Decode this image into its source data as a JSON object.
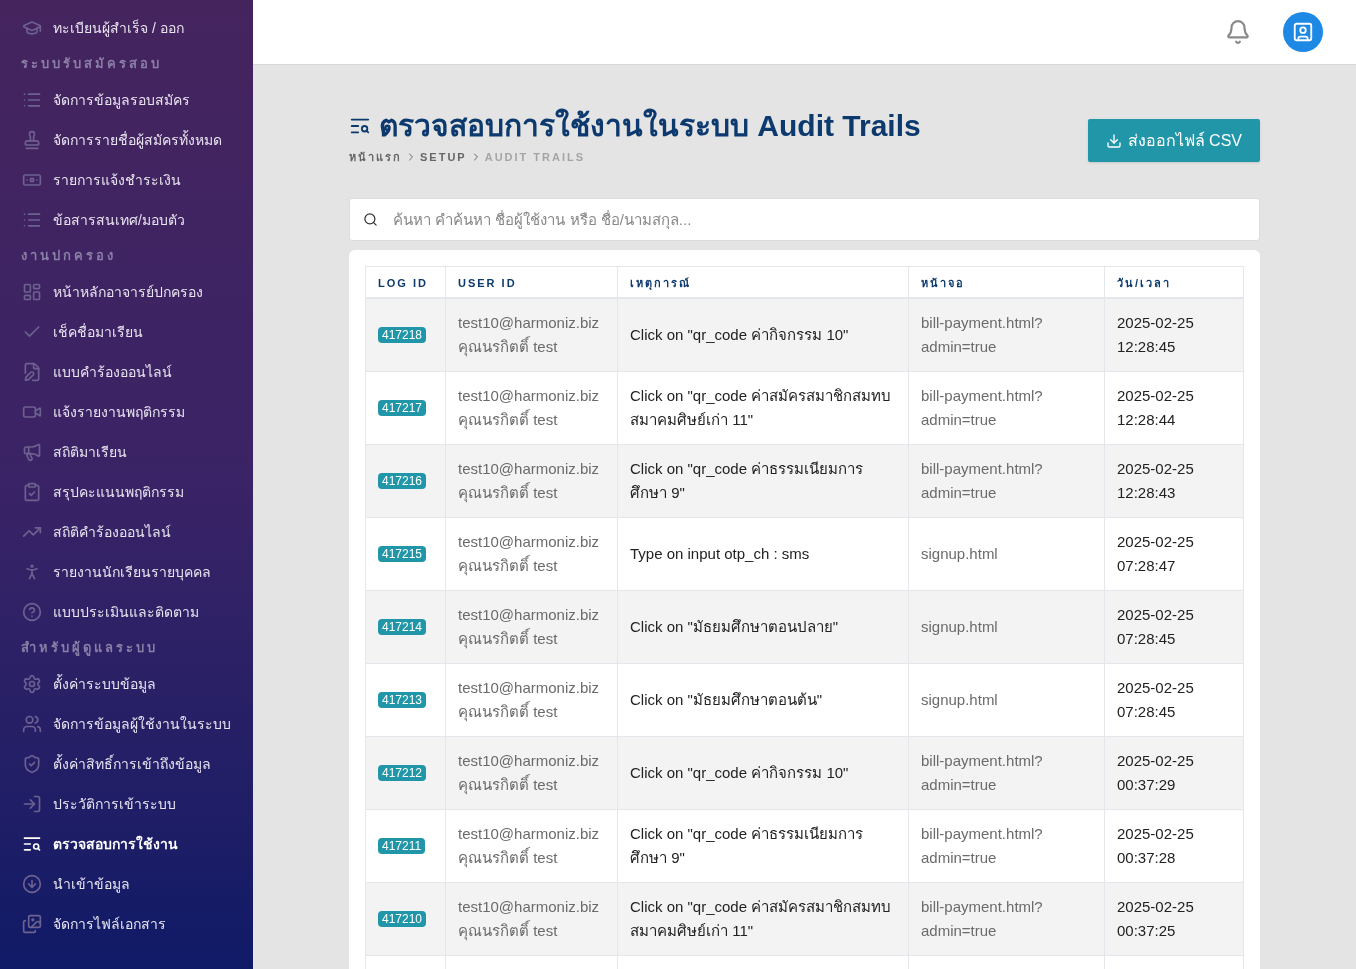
{
  "sidebar": {
    "items": [
      {
        "kind": "item",
        "label": "ทะเบียนผู้สำเร็จ / ออก",
        "selected": false
      },
      {
        "kind": "section",
        "label": "ระบบรับสมัครสอบ"
      },
      {
        "kind": "item",
        "label": "จัดการข้อมูลรอบสมัคร",
        "selected": false
      },
      {
        "kind": "item",
        "label": "จัดการรายชื่อผู้สมัครทั้งหมด",
        "selected": false
      },
      {
        "kind": "item",
        "label": "รายการแจ้งชำระเงิน",
        "selected": false
      },
      {
        "kind": "item",
        "label": "ข้อสารสนเทศ/มอบตัว",
        "selected": false
      },
      {
        "kind": "section",
        "label": "งานปกครอง"
      },
      {
        "kind": "item",
        "label": "หน้าหลักอาจารย์ปกครอง",
        "selected": false
      },
      {
        "kind": "item",
        "label": "เช็คชื่อมาเรียน",
        "selected": false
      },
      {
        "kind": "item",
        "label": "แบบคำร้องออนไลน์",
        "selected": false
      },
      {
        "kind": "item",
        "label": "แจ้งรายงานพฤติกรรม",
        "selected": false
      },
      {
        "kind": "item",
        "label": "สถิติมาเรียน",
        "selected": false
      },
      {
        "kind": "item",
        "label": "สรุปคะแนนพฤติกรรม",
        "selected": false
      },
      {
        "kind": "item",
        "label": "สถิติคำร้องออนไลน์",
        "selected": false
      },
      {
        "kind": "item",
        "label": "รายงานนักเรียนรายบุคคล",
        "selected": false
      },
      {
        "kind": "item",
        "label": "แบบประเมินและติดตาม",
        "selected": false
      },
      {
        "kind": "section",
        "label": "สำหรับผู้ดูแลระบบ"
      },
      {
        "kind": "item",
        "label": "ตั้งค่าระบบข้อมูล",
        "selected": false
      },
      {
        "kind": "item",
        "label": "จัดการข้อมูลผู้ใช้งานในระบบ",
        "selected": false
      },
      {
        "kind": "item",
        "label": "ตั้งค่าสิทธิ์การเข้าถึงข้อมูล",
        "selected": false
      },
      {
        "kind": "item",
        "label": "ประวัติการเข้าระบบ",
        "selected": false
      },
      {
        "kind": "item",
        "label": "ตรวจสอบการใช้งาน",
        "selected": true
      },
      {
        "kind": "item",
        "label": "นำเข้าข้อมูล",
        "selected": false
      },
      {
        "kind": "item",
        "label": "จัดการไฟล์เอกสาร",
        "selected": false
      }
    ]
  },
  "page": {
    "title": "ตรวจสอบการใช้งานในระบบ Audit Trails",
    "breadcrumb": [
      "หน้าแรก",
      "SETUP",
      "AUDIT TRAILS"
    ],
    "export_button": "ส่งออกไฟล์ CSV"
  },
  "search": {
    "placeholder": "ค้นหา คำค้นหา ชื่อผู้ใช้งาน หรือ ชื่อ/นามสกุล..."
  },
  "table": {
    "columns": [
      "LOG ID",
      "USER ID",
      "เหตุการณ์",
      "หน้าจอ",
      "วัน/เวลา"
    ],
    "rows": [
      {
        "log_id": "417218",
        "user": "test10@harmoniz.biz",
        "name": "คุณนรกิตติ์ test",
        "event": "Click on \"qr_code ค่ากิจกรรม 10\"",
        "screen": "bill-payment.html?\nadmin=true",
        "date": "2025-02-25",
        "time": "12:28:45"
      },
      {
        "log_id": "417217",
        "user": "test10@harmoniz.biz",
        "name": "คุณนรกิตติ์ test",
        "event": "Click on \"qr_code ค่าสมัครสมาชิกสมทบ\nสมาคมศิษย์เก่า 11\"",
        "screen": "bill-payment.html?\nadmin=true",
        "date": "2025-02-25",
        "time": "12:28:44"
      },
      {
        "log_id": "417216",
        "user": "test10@harmoniz.biz",
        "name": "คุณนรกิตติ์ test",
        "event": "Click on \"qr_code ค่าธรรมเนียมการ\nศึกษา 9\"",
        "screen": "bill-payment.html?\nadmin=true",
        "date": "2025-02-25",
        "time": "12:28:43"
      },
      {
        "log_id": "417215",
        "user": "test10@harmoniz.biz",
        "name": "คุณนรกิตติ์ test",
        "event": "Type on input otp_ch : sms",
        "screen": "signup.html",
        "date": "2025-02-25",
        "time": "07:28:47"
      },
      {
        "log_id": "417214",
        "user": "test10@harmoniz.biz",
        "name": "คุณนรกิตติ์ test",
        "event": "Click on \"มัธยมศึกษาตอนปลาย\"",
        "screen": "signup.html",
        "date": "2025-02-25",
        "time": "07:28:45"
      },
      {
        "log_id": "417213",
        "user": "test10@harmoniz.biz",
        "name": "คุณนรกิตติ์ test",
        "event": "Click on \"มัธยมศึกษาตอนต้น\"",
        "screen": "signup.html",
        "date": "2025-02-25",
        "time": "07:28:45"
      },
      {
        "log_id": "417212",
        "user": "test10@harmoniz.biz",
        "name": "คุณนรกิตติ์ test",
        "event": "Click on \"qr_code ค่ากิจกรรม 10\"",
        "screen": "bill-payment.html?\nadmin=true",
        "date": "2025-02-25",
        "time": "00:37:29"
      },
      {
        "log_id": "417211",
        "user": "test10@harmoniz.biz",
        "name": "คุณนรกิตติ์ test",
        "event": "Click on \"qr_code ค่าธรรมเนียมการ\nศึกษา 9\"",
        "screen": "bill-payment.html?\nadmin=true",
        "date": "2025-02-25",
        "time": "00:37:28"
      },
      {
        "log_id": "417210",
        "user": "test10@harmoniz.biz",
        "name": "คุณนรกิตติ์ test",
        "event": "Click on \"qr_code ค่าสมัครสมาชิกสมทบ\nสมาคมศิษย์เก่า 11\"",
        "screen": "bill-payment.html?\nadmin=true",
        "date": "2025-02-25",
        "time": "00:37:25"
      }
    ]
  }
}
